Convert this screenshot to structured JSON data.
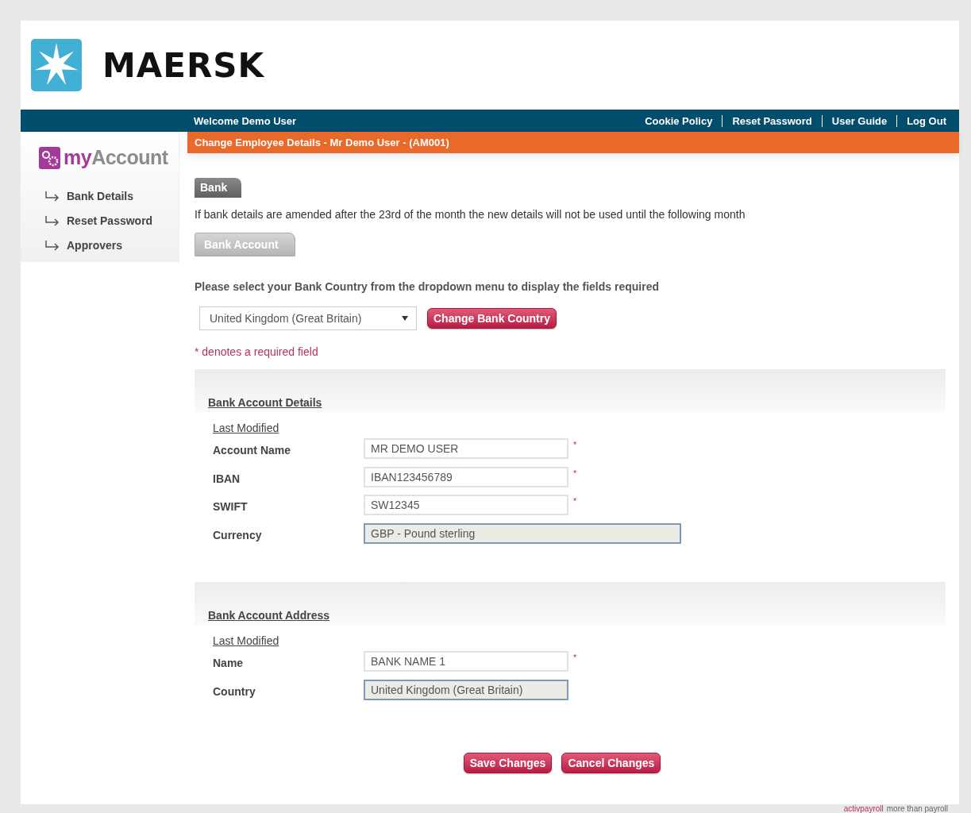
{
  "logo": {
    "wordmark": "MAERSK"
  },
  "topbar": {
    "welcome": "Welcome Demo User",
    "links": [
      "Cookie Policy",
      "Reset Password",
      "User Guide",
      "Log Out"
    ]
  },
  "sidebar": {
    "brand": {
      "prefix": "my",
      "name": "Account"
    },
    "items": [
      {
        "label": "Bank Details"
      },
      {
        "label": "Reset Password"
      },
      {
        "label": "Approvers"
      }
    ]
  },
  "page_title": "Change Employee Details - Mr Demo User - (AM001)",
  "tab": "Bank",
  "notice": "If bank details are amended after the 23rd of the month the new details will not be used until the following month",
  "subtab": "Bank Account",
  "prompt": "Please select your Bank Country from the dropdown menu to display the fields required",
  "country_select": {
    "value": "United Kingdom (Great Britain)",
    "button": "Change Bank Country"
  },
  "required_note": "* denotes a required field",
  "sections": [
    {
      "title": "Bank Account Details",
      "last_modified": "Last Modified",
      "fields": [
        {
          "label": "Account Name",
          "value": "MR DEMO USER",
          "required_mark": "*",
          "readonly": false,
          "wide": false
        },
        {
          "label": "IBAN",
          "value": "IBAN123456789",
          "required_mark": "*",
          "readonly": false,
          "wide": false
        },
        {
          "label": "SWIFT",
          "value": "SW12345",
          "required_mark": "*",
          "readonly": false,
          "wide": false
        },
        {
          "label": "Currency",
          "value": "GBP - Pound sterling",
          "readonly": true,
          "wide": true
        }
      ]
    },
    {
      "title": "Bank Account Address",
      "last_modified": "Last Modified",
      "fields": [
        {
          "label": "Name",
          "value": "BANK NAME 1",
          "required_mark": "*",
          "readonly": false,
          "wide": false
        },
        {
          "label": "Country",
          "value": "United Kingdom (Great Britain)",
          "readonly": true,
          "wide": false
        }
      ]
    }
  ],
  "actions": [
    "Save Changes",
    "Cancel Changes"
  ],
  "footer": {
    "brand": "activpayroll",
    "tagline": "more than payroll"
  }
}
